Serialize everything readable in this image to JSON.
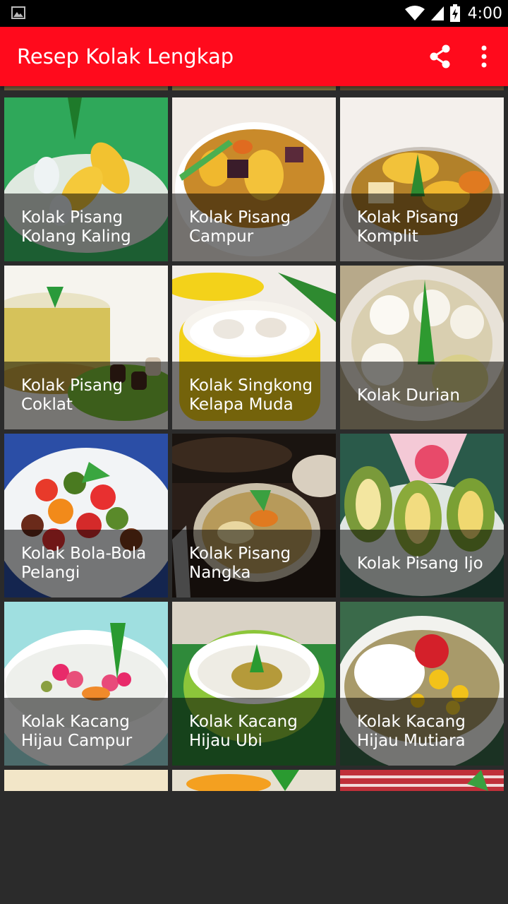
{
  "status_bar": {
    "time": "4:00"
  },
  "app_bar": {
    "title": "Resep Kolak Lengkap"
  },
  "recipes": [
    {
      "name": "Kolak Pisang\nKolang Kaling"
    },
    {
      "name": "Kolak Pisang\nCampur"
    },
    {
      "name": "Kolak Pisang\nKomplit"
    },
    {
      "name": "Kolak Pisang\nCoklat"
    },
    {
      "name": "Kolak Singkong\nKelapa Muda"
    },
    {
      "name": "Kolak Durian"
    },
    {
      "name": "Kolak Bola-Bola\nPelangi"
    },
    {
      "name": "Kolak Pisang\nNangka"
    },
    {
      "name": "Kolak Pisang Ijo"
    },
    {
      "name": "Kolak Kacang\nHijau Campur"
    },
    {
      "name": "Kolak Kacang\nHijau Ubi"
    },
    {
      "name": "Kolak Kacang\nHijau Mutiara"
    }
  ],
  "colors": {
    "app_bar": "#ff0a1c",
    "background": "#2b2b2b"
  }
}
